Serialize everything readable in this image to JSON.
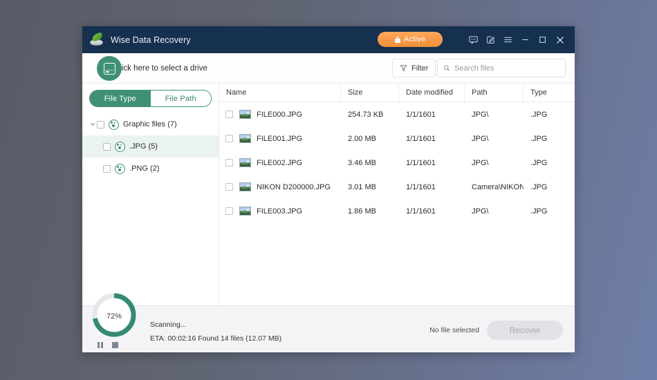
{
  "window": {
    "title": "Wise Data Recovery",
    "logo_icon": "wise-leaf-disc-logo"
  },
  "titlebar": {
    "badge": {
      "label": "Active",
      "icon": "lock-icon",
      "color": "#f29a44"
    },
    "controls": [
      {
        "name": "feedback-icon",
        "label": "Feedback"
      },
      {
        "name": "edit-icon",
        "label": "Edit"
      },
      {
        "name": "menu-icon",
        "label": "Menu"
      },
      {
        "name": "minimize-icon",
        "label": "Minimize"
      },
      {
        "name": "maximize-icon",
        "label": "Maximize"
      },
      {
        "name": "close-icon",
        "label": "Close"
      }
    ]
  },
  "toolbar": {
    "drive_label": "Click here to select a drive",
    "drive_icon": "drive-icon",
    "filter_label": "Filter",
    "filter_icon": "filter-icon",
    "search_placeholder": "Search files",
    "search_value": "",
    "search_icon": "search-icon"
  },
  "sidebar": {
    "toggle": {
      "active": "File Type",
      "inactive": "File Path"
    },
    "tree": [
      {
        "label": "Graphic files (7)",
        "level": 0,
        "expanded": true,
        "checked": false,
        "selected": false
      },
      {
        "label": ".JPG (5)",
        "level": 1,
        "expanded": null,
        "checked": false,
        "selected": true
      },
      {
        "label": ".PNG (2)",
        "level": 1,
        "expanded": null,
        "checked": false,
        "selected": false
      }
    ]
  },
  "table": {
    "columns": [
      "Name",
      "Size",
      "Date modified",
      "Path",
      "Type"
    ],
    "rows": [
      {
        "name": "FILE000.JPG",
        "size": "254.73 KB",
        "date": "1/1/1601",
        "path": "JPG\\",
        "type": ".JPG",
        "checked": false
      },
      {
        "name": "FILE001.JPG",
        "size": "2.00 MB",
        "date": "1/1/1601",
        "path": "JPG\\",
        "type": ".JPG",
        "checked": false
      },
      {
        "name": "FILE002.JPG",
        "size": "3.46 MB",
        "date": "1/1/1601",
        "path": "JPG\\",
        "type": ".JPG",
        "checked": false
      },
      {
        "name": "NIKON D200000.JPG",
        "size": "3.01 MB",
        "date": "1/1/1601",
        "path": "Camera\\NIKON C...",
        "type": ".JPG",
        "checked": false
      },
      {
        "name": "FILE003.JPG",
        "size": "1.86 MB",
        "date": "1/1/1601",
        "path": "JPG\\",
        "type": ".JPG",
        "checked": false
      }
    ]
  },
  "status": {
    "progress_percent": 72,
    "progress_label": "72%",
    "progress_color": "#348a72",
    "scan_state": "Scanning...",
    "scan_detail": "ETA: 00:02:16 Found 14 files (12.07 MB)",
    "pause_icon": "pause-icon",
    "stop_icon": "stop-icon",
    "selection_text": "No file selected",
    "recover_label": "Recover",
    "recover_enabled": false
  }
}
